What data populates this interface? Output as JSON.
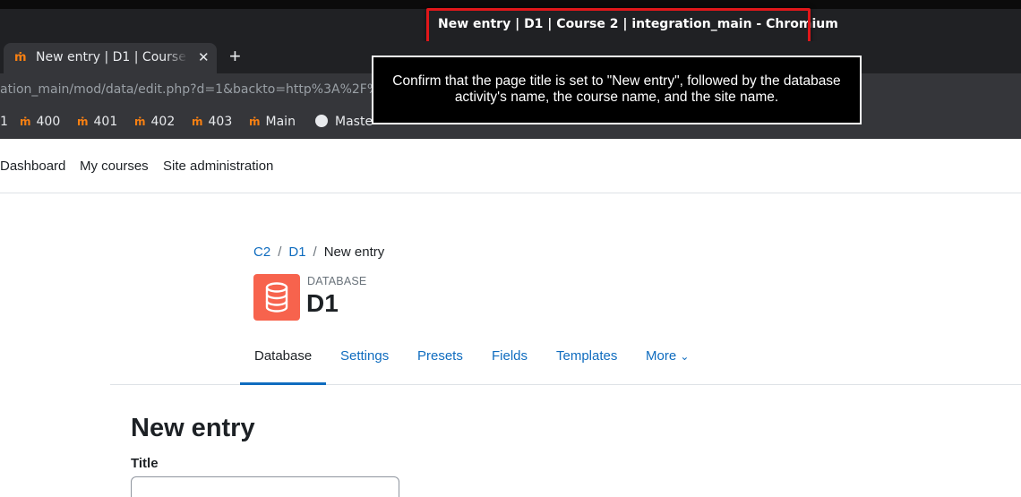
{
  "browser": {
    "window_title": "New entry | D1 | Course 2 | integration_main - Chromium",
    "tab": {
      "favicon_text": "ṁ",
      "title": "New entry | D1 | Course 2 | integration_main",
      "close_glyph": "✕"
    },
    "new_tab_glyph": "+",
    "url": "ation_main/mod/data/edit.php?d=1&backto=http%3A%2F%2Floc",
    "bookmarks": [
      {
        "label": "1"
      },
      {
        "label": "400"
      },
      {
        "label": "401"
      },
      {
        "label": "402"
      },
      {
        "label": "403"
      },
      {
        "label": "Main"
      },
      {
        "label": "Maste"
      }
    ],
    "bookmark_favicon_text": "ṁ"
  },
  "tooltip": {
    "text": "Confirm that the page title is set to \"New entry\", followed by the database activity's name, the course name, and the site name."
  },
  "nav": {
    "items": [
      "Dashboard",
      "My courses",
      "Site administration"
    ]
  },
  "breadcrumb": {
    "items": [
      "C2",
      "D1",
      "New entry"
    ],
    "separator": "/"
  },
  "activity": {
    "type": "DATABASE",
    "name": "D1",
    "icon": "database-icon",
    "icon_color": "#f7634d"
  },
  "secondary_nav": {
    "tabs": [
      "Database",
      "Settings",
      "Presets",
      "Fields",
      "Templates"
    ],
    "more_label": "More",
    "more_glyph": "⌄",
    "active_index": 0
  },
  "content": {
    "heading": "New entry",
    "field_label": "Title",
    "field_value": ""
  },
  "colors": {
    "link": "#0f6cbf",
    "highlight": "#e0171a",
    "moodle_orange": "#f98012"
  }
}
